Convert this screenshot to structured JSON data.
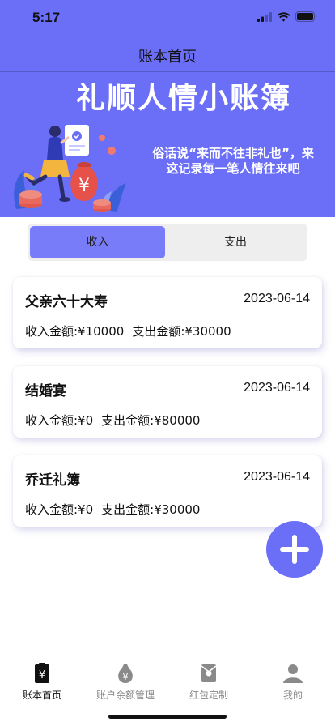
{
  "status": {
    "time": "5:17"
  },
  "nav": {
    "title": "账本首页"
  },
  "banner": {
    "title": "礼顺人情小账簿",
    "motto": "俗话说“来而不往非礼也”，来这记录每一笔人情往来吧",
    "illustration": "woman-with-money-bag-illustration"
  },
  "segment": {
    "income_label": "收入",
    "expense_label": "支出",
    "selected": "income"
  },
  "records": [
    {
      "name": "父亲六十大寿",
      "date": "2023-06-14",
      "income": "收入金额:¥10000",
      "expense": "支出金额:¥30000"
    },
    {
      "name": "结婚宴",
      "date": "2023-06-14",
      "income": "收入金额:¥0",
      "expense": "支出金额:¥80000"
    },
    {
      "name": "乔迁礼簿",
      "date": "2023-06-14",
      "income": "收入金额:¥0",
      "expense": "支出金额:¥30000"
    }
  ],
  "fab": {
    "icon": "plus-icon"
  },
  "tabbar": {
    "items": [
      {
        "label": "账本首页",
        "icon": "ledger-icon",
        "active": true
      },
      {
        "label": "账户余额管理",
        "icon": "money-bag-icon",
        "active": false
      },
      {
        "label": "红包定制",
        "icon": "red-envelope-icon",
        "active": false
      },
      {
        "label": "我的",
        "icon": "person-icon",
        "active": false
      }
    ]
  },
  "colors": {
    "primary": "#6b6ff7",
    "segment_active": "#787cf8",
    "segment_bg": "#eeeeee"
  }
}
